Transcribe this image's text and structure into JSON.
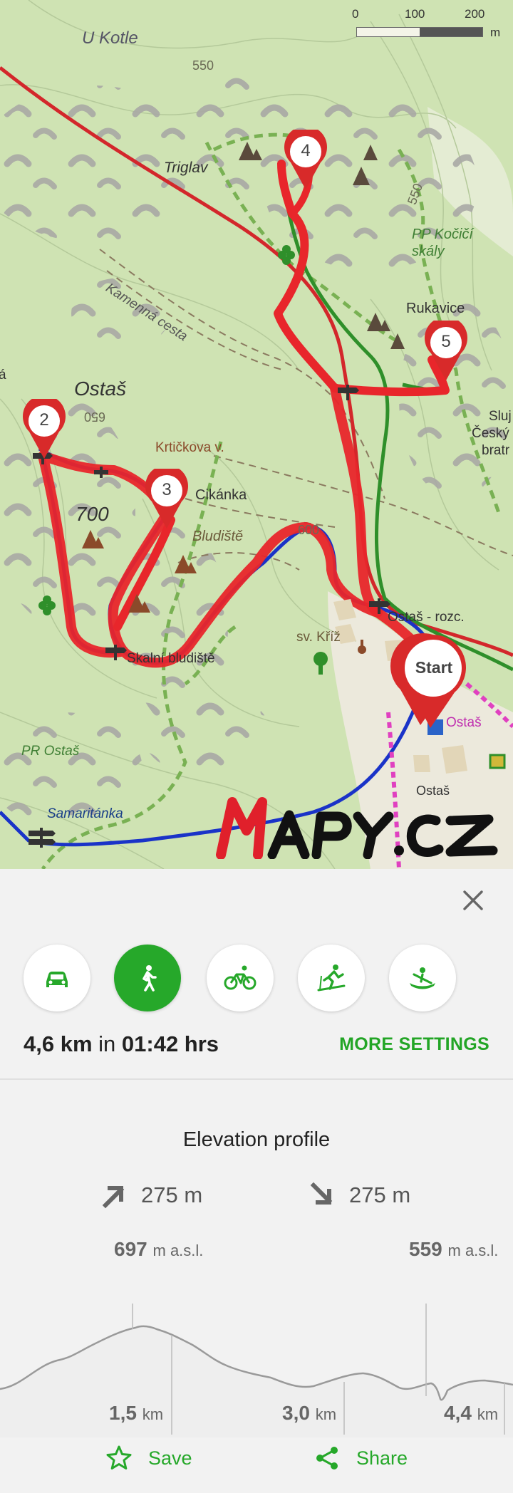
{
  "map": {
    "labels": {
      "u_kotle": "U Kotle",
      "contour_550_top": "550",
      "triglav": "Triglav",
      "contour_550_right": "550",
      "pp_kocici_1": "PP Kočičí",
      "pp_kocici_2": "skály",
      "kamenna_cesta": "Kamenná cesta",
      "rukavice": "Rukavice",
      "ostas_big": "Ostaš",
      "contour_650": "650",
      "krtickova": "Krtičkova v.",
      "cikanka": "Cikánka",
      "elev_700": "700",
      "bludiste": "Bludiště",
      "contour_600": "600",
      "ostas_rozc": "Ostaš - rozc.",
      "sv_kriz": "sv. Kříž",
      "skalni_bludiste": "Skalní bludiště",
      "pr_ostas": "PR Ostaš",
      "ostas_poi": "Ostaš",
      "ostas_village": "Ostaš",
      "samaritanka": "Samaritánka",
      "sluj_1": "Sluj",
      "sluj_2": "Český",
      "sluj_3": "bratr",
      "left_edge": "á"
    },
    "scale": {
      "ticks": [
        "0",
        "100",
        "200"
      ],
      "unit": "m"
    },
    "waypoints": {
      "p2": "2",
      "p3": "3",
      "p4": "4",
      "p5": "5",
      "start": "Start"
    },
    "logo": "MAPY.CZ",
    "colors": {
      "route": "#e8262b",
      "trail_blue": "#1a33c8",
      "trail_green": "#2f8f2a",
      "road": "#d3272b",
      "pink": "#e040c0"
    }
  },
  "panel": {
    "modes": [
      {
        "name": "car",
        "icon": "car-icon",
        "active": false
      },
      {
        "name": "walk",
        "icon": "walking-icon",
        "active": true
      },
      {
        "name": "bike",
        "icon": "bicycle-icon",
        "active": false
      },
      {
        "name": "ski",
        "icon": "skiing-icon",
        "active": false
      },
      {
        "name": "canoe",
        "icon": "canoe-icon",
        "active": false
      }
    ],
    "distance": "4,6 km",
    "in_text": "in",
    "duration": "01:42 hrs",
    "more_settings": "MORE SETTINGS",
    "accent": "#26a82a"
  },
  "elevation": {
    "title": "Elevation profile",
    "ascent": "275 m",
    "descent": "275 m",
    "max_value": "697",
    "min_value": "559",
    "unit_asl": "m a.s.l.",
    "distances": [
      {
        "value": "1,5",
        "unit": "km"
      },
      {
        "value": "3,0",
        "unit": "km"
      },
      {
        "value": "4,4",
        "unit": "km"
      }
    ],
    "save_label": "Save",
    "share_label": "Share"
  }
}
